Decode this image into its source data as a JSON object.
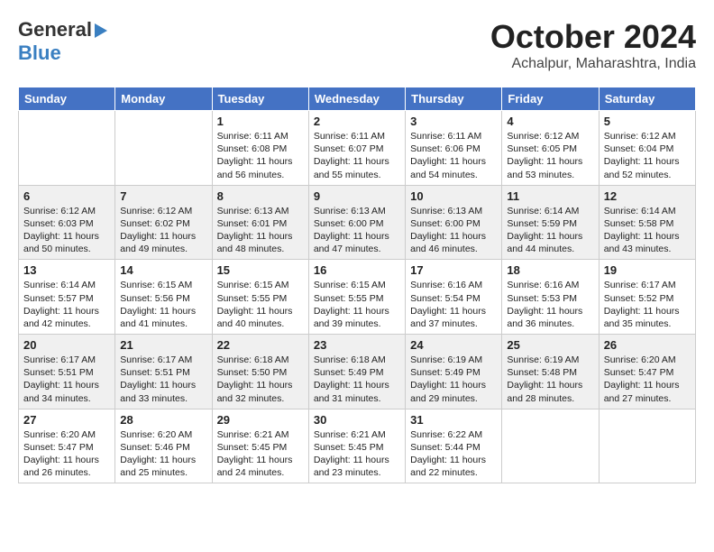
{
  "header": {
    "logo_general": "General",
    "logo_blue": "Blue",
    "month": "October 2024",
    "location": "Achalpur, Maharashtra, India"
  },
  "weekdays": [
    "Sunday",
    "Monday",
    "Tuesday",
    "Wednesday",
    "Thursday",
    "Friday",
    "Saturday"
  ],
  "weeks": [
    [
      {
        "day": "",
        "info": ""
      },
      {
        "day": "",
        "info": ""
      },
      {
        "day": "1",
        "info": "Sunrise: 6:11 AM\nSunset: 6:08 PM\nDaylight: 11 hours and 56 minutes."
      },
      {
        "day": "2",
        "info": "Sunrise: 6:11 AM\nSunset: 6:07 PM\nDaylight: 11 hours and 55 minutes."
      },
      {
        "day": "3",
        "info": "Sunrise: 6:11 AM\nSunset: 6:06 PM\nDaylight: 11 hours and 54 minutes."
      },
      {
        "day": "4",
        "info": "Sunrise: 6:12 AM\nSunset: 6:05 PM\nDaylight: 11 hours and 53 minutes."
      },
      {
        "day": "5",
        "info": "Sunrise: 6:12 AM\nSunset: 6:04 PM\nDaylight: 11 hours and 52 minutes."
      }
    ],
    [
      {
        "day": "6",
        "info": "Sunrise: 6:12 AM\nSunset: 6:03 PM\nDaylight: 11 hours and 50 minutes."
      },
      {
        "day": "7",
        "info": "Sunrise: 6:12 AM\nSunset: 6:02 PM\nDaylight: 11 hours and 49 minutes."
      },
      {
        "day": "8",
        "info": "Sunrise: 6:13 AM\nSunset: 6:01 PM\nDaylight: 11 hours and 48 minutes."
      },
      {
        "day": "9",
        "info": "Sunrise: 6:13 AM\nSunset: 6:00 PM\nDaylight: 11 hours and 47 minutes."
      },
      {
        "day": "10",
        "info": "Sunrise: 6:13 AM\nSunset: 6:00 PM\nDaylight: 11 hours and 46 minutes."
      },
      {
        "day": "11",
        "info": "Sunrise: 6:14 AM\nSunset: 5:59 PM\nDaylight: 11 hours and 44 minutes."
      },
      {
        "day": "12",
        "info": "Sunrise: 6:14 AM\nSunset: 5:58 PM\nDaylight: 11 hours and 43 minutes."
      }
    ],
    [
      {
        "day": "13",
        "info": "Sunrise: 6:14 AM\nSunset: 5:57 PM\nDaylight: 11 hours and 42 minutes."
      },
      {
        "day": "14",
        "info": "Sunrise: 6:15 AM\nSunset: 5:56 PM\nDaylight: 11 hours and 41 minutes."
      },
      {
        "day": "15",
        "info": "Sunrise: 6:15 AM\nSunset: 5:55 PM\nDaylight: 11 hours and 40 minutes."
      },
      {
        "day": "16",
        "info": "Sunrise: 6:15 AM\nSunset: 5:55 PM\nDaylight: 11 hours and 39 minutes."
      },
      {
        "day": "17",
        "info": "Sunrise: 6:16 AM\nSunset: 5:54 PM\nDaylight: 11 hours and 37 minutes."
      },
      {
        "day": "18",
        "info": "Sunrise: 6:16 AM\nSunset: 5:53 PM\nDaylight: 11 hours and 36 minutes."
      },
      {
        "day": "19",
        "info": "Sunrise: 6:17 AM\nSunset: 5:52 PM\nDaylight: 11 hours and 35 minutes."
      }
    ],
    [
      {
        "day": "20",
        "info": "Sunrise: 6:17 AM\nSunset: 5:51 PM\nDaylight: 11 hours and 34 minutes."
      },
      {
        "day": "21",
        "info": "Sunrise: 6:17 AM\nSunset: 5:51 PM\nDaylight: 11 hours and 33 minutes."
      },
      {
        "day": "22",
        "info": "Sunrise: 6:18 AM\nSunset: 5:50 PM\nDaylight: 11 hours and 32 minutes."
      },
      {
        "day": "23",
        "info": "Sunrise: 6:18 AM\nSunset: 5:49 PM\nDaylight: 11 hours and 31 minutes."
      },
      {
        "day": "24",
        "info": "Sunrise: 6:19 AM\nSunset: 5:49 PM\nDaylight: 11 hours and 29 minutes."
      },
      {
        "day": "25",
        "info": "Sunrise: 6:19 AM\nSunset: 5:48 PM\nDaylight: 11 hours and 28 minutes."
      },
      {
        "day": "26",
        "info": "Sunrise: 6:20 AM\nSunset: 5:47 PM\nDaylight: 11 hours and 27 minutes."
      }
    ],
    [
      {
        "day": "27",
        "info": "Sunrise: 6:20 AM\nSunset: 5:47 PM\nDaylight: 11 hours and 26 minutes."
      },
      {
        "day": "28",
        "info": "Sunrise: 6:20 AM\nSunset: 5:46 PM\nDaylight: 11 hours and 25 minutes."
      },
      {
        "day": "29",
        "info": "Sunrise: 6:21 AM\nSunset: 5:45 PM\nDaylight: 11 hours and 24 minutes."
      },
      {
        "day": "30",
        "info": "Sunrise: 6:21 AM\nSunset: 5:45 PM\nDaylight: 11 hours and 23 minutes."
      },
      {
        "day": "31",
        "info": "Sunrise: 6:22 AM\nSunset: 5:44 PM\nDaylight: 11 hours and 22 minutes."
      },
      {
        "day": "",
        "info": ""
      },
      {
        "day": "",
        "info": ""
      }
    ]
  ]
}
